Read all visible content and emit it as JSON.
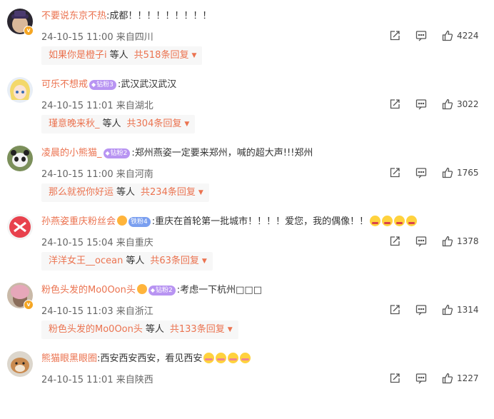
{
  "comments": [
    {
      "username": "不要说东京不热",
      "badge": "",
      "text": ":成都！！！！！！！！！",
      "time": "24-10-15 11:00",
      "location": "来自四川",
      "likes": "4224",
      "reply_user": "如果你是橙子i",
      "reply_etc": "等人",
      "reply_count": "共518条回复"
    },
    {
      "username": "可乐不想戒",
      "badge": "钻粉3",
      "text": ":武汉武汉武汉",
      "time": "24-10-15 11:01",
      "location": "来自湖北",
      "likes": "3022",
      "reply_user": "瑾意晚来秋_",
      "reply_etc": "等人",
      "reply_count": "共304条回复"
    },
    {
      "username": "凌晨的小熊猫_",
      "badge": "钻粉2",
      "text": ":郑州燕姿一定要来郑州，喊的超大声!!!郑州",
      "time": "24-10-15 11:00",
      "location": "来自河南",
      "likes": "1765",
      "reply_user": "那么就祝你好运",
      "reply_etc": "等人",
      "reply_count": "共234条回复"
    },
    {
      "username": "孙燕姿重庆粉丝会",
      "badge": "铁粉4",
      "text": ":重庆在首轮第一批城市！！！！爱您，我的偶像！！",
      "time": "24-10-15 15:04",
      "location": "来自重庆",
      "likes": "1378",
      "reply_user": "洋洋女王__ocean",
      "reply_etc": "等人",
      "reply_count": "共63条回复"
    },
    {
      "username": "粉色头发的Mo0Oon头",
      "badge": "钻粉2",
      "text": ":考虑一下杭州□□□",
      "time": "24-10-15 11:03",
      "location": "来自浙江",
      "likes": "1314",
      "reply_user": "粉色头发的Mo0Oon头",
      "reply_etc": "等人",
      "reply_count": "共133条回复"
    },
    {
      "username": "熊猫眼黑眼圈",
      "badge": "",
      "text": ":西安西安西安，看见西安",
      "time": "24-10-15 11:01",
      "location": "来自陕西",
      "likes": "1227",
      "reply_user": "",
      "reply_etc": "",
      "reply_count": ""
    }
  ],
  "icons": {
    "share": "share-icon",
    "comment": "comment-icon",
    "like": "like-icon"
  },
  "colors": {
    "username": "#eb7350",
    "reply_bg": "#f7f7f7"
  }
}
